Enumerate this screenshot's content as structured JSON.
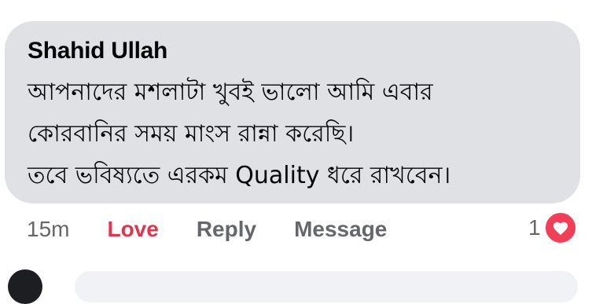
{
  "comment": {
    "author": "Shahid Ullah",
    "text": "আপনাদের মশলাটা খুবই ভালো আমি এবার\nকোরবানির সময় মাংস রান্না করেছি।\nতবে ভবিষ্যতে এরকম Quality ধরে রাখবেন।",
    "time": "15m",
    "love_label": "Love",
    "reply_label": "Reply",
    "message_label": "Message",
    "reaction_count": "1",
    "reaction_icon": "heart-icon"
  },
  "colors": {
    "bubble": "#dfe1e5",
    "love": "#e3344d",
    "secondary_text": "#65676b",
    "heart": "#f33e58"
  }
}
